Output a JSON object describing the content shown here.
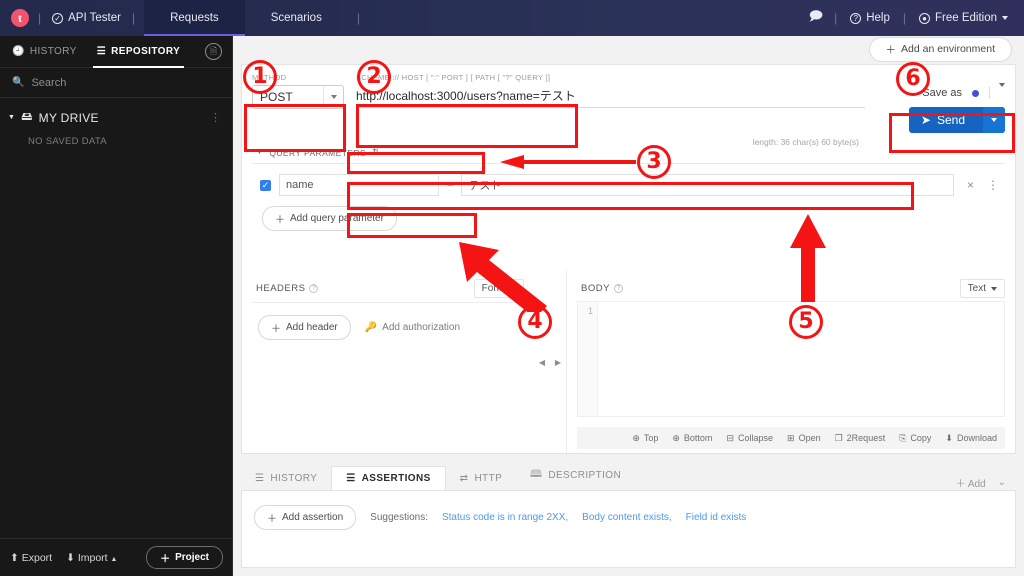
{
  "topbar": {
    "logo_letter": "t",
    "app_name": "API Tester",
    "tabs": [
      {
        "label": "Requests",
        "active": true
      },
      {
        "label": "Scenarios",
        "active": false
      }
    ],
    "help_label": "Help",
    "account_label": "Free Edition",
    "separator": "|",
    "bg_color": "#252c50"
  },
  "sidebar": {
    "tabs": [
      {
        "label": "HISTORY",
        "active": false
      },
      {
        "label": "REPOSITORY",
        "active": true
      }
    ],
    "search_placeholder": "Search",
    "drive_label": "MY DRIVE",
    "empty_label": "NO SAVED DATA",
    "export_label": "Export",
    "import_label": "Import",
    "project_label": "Project",
    "bg_color": "#181818"
  },
  "environment": {
    "add_label": "Add an environment"
  },
  "request": {
    "method_label": "METHOD",
    "method_value": "POST",
    "url_label": "SCHEME :// HOST [ \":\" PORT ] [ PATH [ \"?\" QUERY ]]",
    "url_value": "http://localhost:3000/users?name=テスト",
    "length_note": "length: 36 char(s) 60 byte(s)",
    "save_as_label": "Save as",
    "send_label": "Send"
  },
  "query_parameters": {
    "section_label": "QUERY PARAMETERS",
    "rows": [
      {
        "enabled": true,
        "key": "name",
        "equals": "=",
        "value": "テスト",
        "remove": "×",
        "menu": "⋮"
      }
    ],
    "add_label": "Add query parameter",
    "delete_icon": "trash-icon"
  },
  "headers_pane": {
    "title": "HEADERS",
    "format_value": "Form",
    "add_header_label": "Add header",
    "add_auth_label": "Add authorization"
  },
  "body_pane": {
    "title": "BODY",
    "type_value": "Text",
    "line_number": "1",
    "toolbar": [
      {
        "label": "Top",
        "icon": "arrow-up-circle-icon"
      },
      {
        "label": "Bottom",
        "icon": "arrow-down-circle-icon"
      },
      {
        "label": "Collapse",
        "icon": "collapse-icon"
      },
      {
        "label": "Open",
        "icon": "open-icon"
      },
      {
        "label": "2Request",
        "icon": "copy-to-request-icon"
      },
      {
        "label": "Copy",
        "icon": "copy-icon"
      },
      {
        "label": "Download",
        "icon": "download-icon"
      }
    ]
  },
  "bottom": {
    "tabs": [
      {
        "label": "HISTORY",
        "active": false
      },
      {
        "label": "ASSERTIONS",
        "active": true
      },
      {
        "label": "HTTP",
        "active": false
      },
      {
        "label": "DESCRIPTION",
        "active": false
      }
    ],
    "add_label": "Add",
    "add_assertion_label": "Add assertion",
    "suggestions_label": "Suggestions:",
    "suggestions": [
      "Status code is in range 2XX,",
      "Body content exists,",
      "Field id exists"
    ]
  },
  "annotations": {
    "color": "#f41414",
    "numbers": [
      "①",
      "②",
      "③",
      "④",
      "⑤",
      "⑥"
    ],
    "labels": {
      "n1": "1",
      "n2": "2",
      "n3": "3",
      "n4": "4",
      "n5": "5",
      "n6": "6"
    }
  }
}
